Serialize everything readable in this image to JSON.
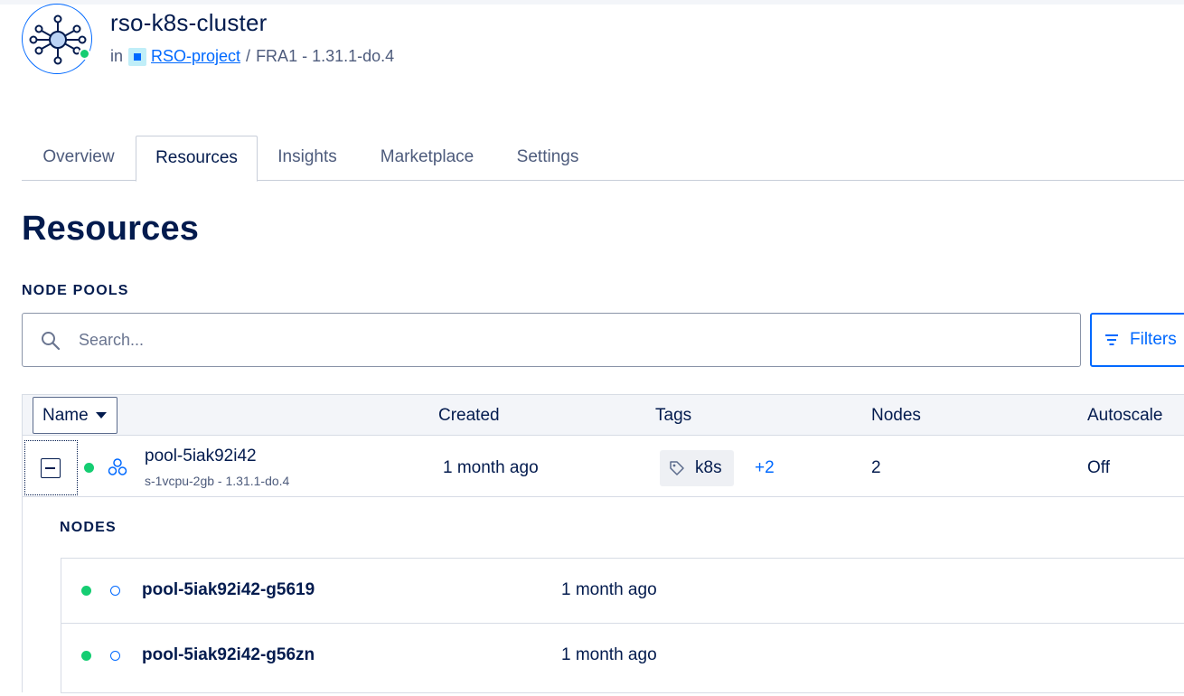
{
  "header": {
    "cluster_name": "rso-k8s-cluster",
    "in_label": "in",
    "project_name": "RSO-project",
    "separator": "/",
    "region_version": "FRA1 - 1.31.1-do.4",
    "status_color": "#15cd72"
  },
  "tabs": [
    {
      "label": "Overview",
      "active": false
    },
    {
      "label": "Resources",
      "active": true
    },
    {
      "label": "Insights",
      "active": false
    },
    {
      "label": "Marketplace",
      "active": false
    },
    {
      "label": "Settings",
      "active": false
    }
  ],
  "page_title": "Resources",
  "node_pools": {
    "section_label": "NODE POOLS",
    "search_placeholder": "Search...",
    "search_icon": "search-icon",
    "filters_label": "Filters",
    "columns": {
      "name": "Name",
      "created": "Created",
      "tags": "Tags",
      "nodes": "Nodes",
      "autoscale": "Autoscale"
    },
    "pools": [
      {
        "name": "pool-5iak92i42",
        "size": "s-1vcpu-2gb - 1.31.1-do.4",
        "created": "1 month ago",
        "tag": "k8s",
        "more_tags": "+2",
        "nodes": "2",
        "autoscale": "Off",
        "nodes_label": "NODES",
        "node_list": [
          {
            "name": "pool-5iak92i42-g5619",
            "created": "1 month ago"
          },
          {
            "name": "pool-5iak92i42-g56zn",
            "created": "1 month ago"
          }
        ]
      }
    ]
  },
  "colors": {
    "accent": "#0069ff",
    "text": "#031b4e",
    "status_ok": "#15cd72"
  }
}
